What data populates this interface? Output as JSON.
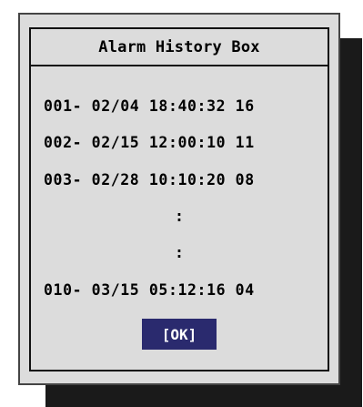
{
  "dialog": {
    "title": "Alarm History Box",
    "entries": [
      "001- 02/04 18:40:32 16",
      "002- 02/15 12:00:10 11",
      "003- 02/28 10:10:20 08",
      "010- 03/15 05:12:16 04"
    ],
    "ellipsis": [
      ":",
      ":"
    ],
    "ok_label": "[OK]"
  },
  "colors": {
    "dialog_background": "#dcdcdc",
    "button_background": "#2a2a6e",
    "shadow": "#1a1a1a"
  }
}
